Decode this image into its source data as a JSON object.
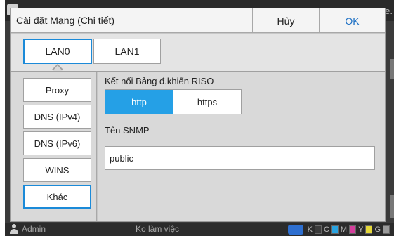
{
  "dialog": {
    "title": "Cài đặt Mạng (Chi tiết)",
    "cancel_label": "Hủy",
    "ok_label": "OK"
  },
  "tabs": [
    {
      "label": "LAN0",
      "selected": true
    },
    {
      "label": "LAN1",
      "selected": false
    }
  ],
  "nav": [
    {
      "label": "Proxy",
      "selected": false
    },
    {
      "label": "DNS (IPv4)",
      "selected": false
    },
    {
      "label": "DNS (IPv6)",
      "selected": false
    },
    {
      "label": "WINS",
      "selected": false
    },
    {
      "label": "Khác",
      "selected": true
    }
  ],
  "riso": {
    "label": "Kết nối Bảng đ.khiển RISO",
    "options": [
      "http",
      "https"
    ],
    "selected": "http"
  },
  "snmp": {
    "label": "Tên SNMP",
    "value": "public"
  },
  "statusbar": {
    "user": "Admin",
    "status": "Ko làm việc",
    "ink_labels": [
      "K",
      "C",
      "M",
      "Y",
      "G"
    ],
    "ink_colors": [
      "#3a3a3a",
      "#29a3e0",
      "#d43f9c",
      "#e5d83a",
      "#9a9a9a"
    ]
  },
  "background": {
    "right_fragment": "e."
  },
  "colors": {
    "accent": "#1b8ad8",
    "selected_fill": "#25a0e6",
    "ok_text": "#1c6fc4"
  }
}
